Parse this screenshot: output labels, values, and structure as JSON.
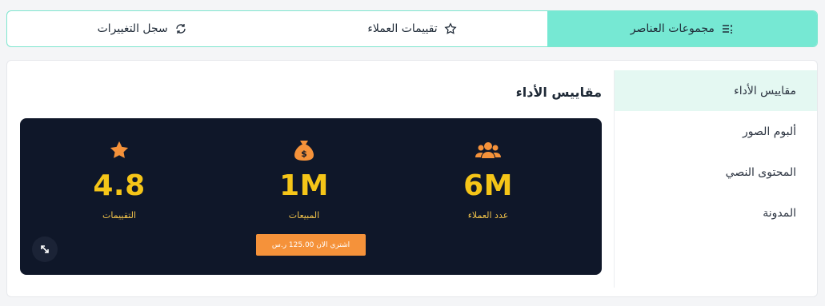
{
  "tabs": [
    {
      "label": "مجموعات العناصر",
      "icon": "list-ordered-icon",
      "active": true
    },
    {
      "label": "تقييمات العملاء",
      "icon": "star-outline-icon",
      "active": false
    },
    {
      "label": "سجل التغييرات",
      "icon": "refresh-chat-icon",
      "active": false
    }
  ],
  "sidebar": {
    "items": [
      {
        "label": "مقاييس الأداء",
        "active": true
      },
      {
        "label": "ألبوم الصور",
        "active": false
      },
      {
        "label": "المحتوى النصي",
        "active": false
      },
      {
        "label": "المدونة",
        "active": false
      }
    ]
  },
  "content": {
    "title": "مقاييس الأداء",
    "stats": [
      {
        "value": "6M",
        "label": "عدد العملاء",
        "icon": "users-icon"
      },
      {
        "value": "1M",
        "label": "المبيعات",
        "icon": "money-bag-icon"
      },
      {
        "value": "4.8",
        "label": "التقييمات",
        "icon": "star-icon"
      }
    ],
    "buy_button": "اشتري الان 125.00 ر.س",
    "expand_icon": "expand-arrows-icon"
  },
  "colors": {
    "tab_active": "#76e8d3",
    "panel_bg": "#0f1729",
    "value_color": "#f5c518",
    "icon_color": "#f5923a",
    "button_bg": "#f5923a"
  }
}
